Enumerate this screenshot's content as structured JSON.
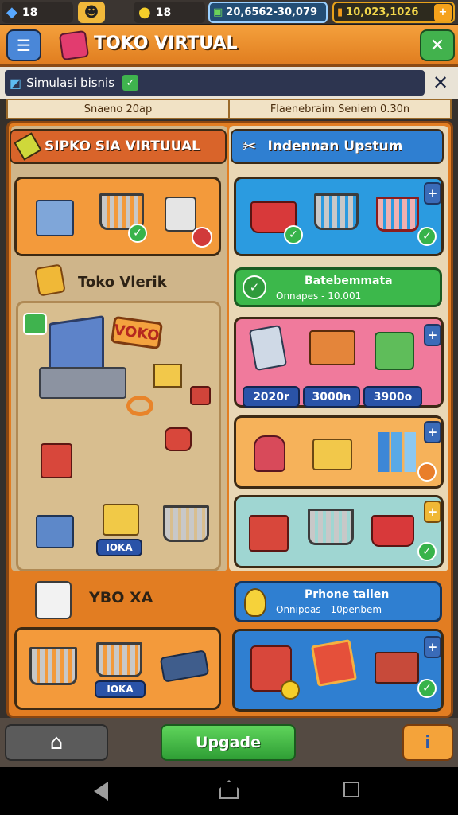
{
  "status": {
    "gems": "18",
    "coins": "18",
    "cash": "20,6562-30,079",
    "gold": "10,023,1026",
    "plus": "+"
  },
  "title": {
    "text": "TOKO VIRTUAL",
    "close": "✕"
  },
  "search": {
    "value": "Simulasi bisnis",
    "close": "✕"
  },
  "tabs": [
    "Snaeno 20ap",
    "Flaenebraim Seniem 0.30n"
  ],
  "left": {
    "header": "SIPKO SIA VIRTUUAL",
    "store_label": "Toko Vlerik",
    "sign": "VOKO",
    "bottom_header": "YBO XA",
    "tag1": "IOKA",
    "tag2": "IOKA"
  },
  "right": {
    "header": "Indennan Upstum",
    "banner1_title": "Batebemmata",
    "banner1_sub": "Onnapes - 10.001",
    "prices": [
      "2020r",
      "3000n",
      "3900o"
    ],
    "banner2_title": "Prhone tallen",
    "banner2_sub": "Onnipoas - 10penbem",
    "plus": "+"
  },
  "bottom": {
    "upgrade": "Upgade",
    "info": "i"
  },
  "colors": {
    "orange": "#e27d22",
    "blue": "#2f7fd1",
    "green": "#39b54a"
  }
}
